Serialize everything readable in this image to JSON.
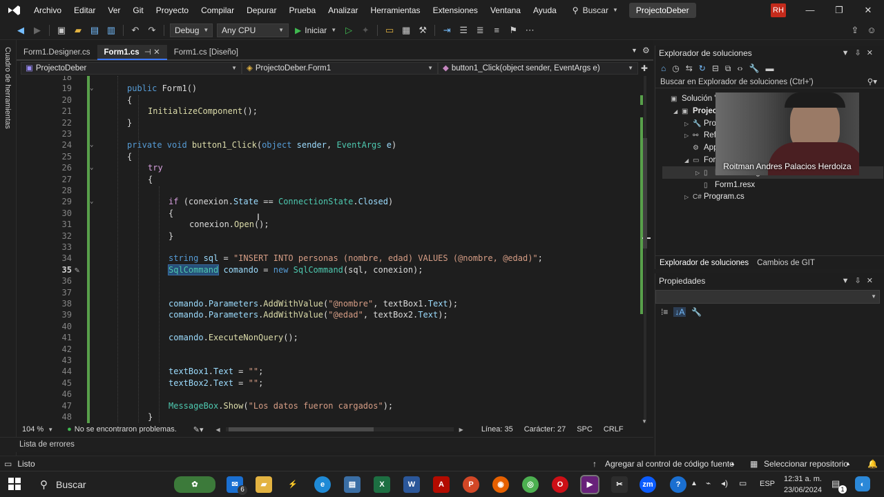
{
  "menubar": {
    "items": [
      "Archivo",
      "Editar",
      "Ver",
      "Git",
      "Proyecto",
      "Compilar",
      "Depurar",
      "Prueba",
      "Analizar",
      "Herramientas",
      "Extensiones",
      "Ventana",
      "Ayuda"
    ],
    "search_label": "Buscar",
    "project_name": "ProjectoDeber",
    "user_initials": "RH"
  },
  "toolbar": {
    "config": "Debug",
    "platform": "Any CPU",
    "run_label": "Iniciar"
  },
  "left_tab": "Cuadro de herramientas",
  "editor": {
    "tabs": [
      {
        "label": "Form1.Designer.cs",
        "active": false
      },
      {
        "label": "Form1.cs",
        "active": true
      },
      {
        "label": "Form1.cs [Diseño]",
        "active": false
      }
    ],
    "nav_project": "ProjectoDeber",
    "nav_class": "ProjectoDeber.Form1",
    "nav_member": "button1_Click(object sender, EventArgs e)",
    "zoom": "104 %",
    "problems": "No se encontraron problemas.",
    "line": "Línea: 35",
    "char": "Carácter: 27",
    "spc": "SPC",
    "crlf": "CRLF",
    "current_line": 35,
    "code_lines": [
      {
        "n": "18",
        "tokens": []
      },
      {
        "n": "19",
        "tokens": [
          [
            "kw",
            "public "
          ],
          [
            "tx",
            "Form1()"
          ]
        ],
        "indent": 2
      },
      {
        "n": "20",
        "tokens": [
          [
            "tx",
            "{"
          ]
        ],
        "indent": 2
      },
      {
        "n": "21",
        "tokens": [
          [
            "fn",
            "InitializeComponent"
          ],
          [
            "tx",
            "();"
          ]
        ],
        "indent": 3
      },
      {
        "n": "22",
        "tokens": [
          [
            "tx",
            "}"
          ]
        ],
        "indent": 2
      },
      {
        "n": "23",
        "tokens": []
      },
      {
        "n": "24",
        "tokens": [
          [
            "kw",
            "private void "
          ],
          [
            "fn",
            "button1_Click"
          ],
          [
            "tx",
            "("
          ],
          [
            "kw",
            "object "
          ],
          [
            "id",
            "sender"
          ],
          [
            "tx",
            ", "
          ],
          [
            "ty",
            "EventArgs "
          ],
          [
            "id",
            "e"
          ],
          [
            "tx",
            ")"
          ]
        ],
        "indent": 2
      },
      {
        "n": "25",
        "tokens": [
          [
            "tx",
            "{"
          ]
        ],
        "indent": 2
      },
      {
        "n": "26",
        "tokens": [
          [
            "kw2",
            "try"
          ]
        ],
        "indent": 3
      },
      {
        "n": "27",
        "tokens": [
          [
            "tx",
            "{"
          ]
        ],
        "indent": 3
      },
      {
        "n": "28",
        "tokens": []
      },
      {
        "n": "29",
        "tokens": [
          [
            "kw2",
            "if "
          ],
          [
            "tx",
            "(conexion."
          ],
          [
            "id",
            "State"
          ],
          [
            "tx",
            " == "
          ],
          [
            "ty",
            "ConnectionState"
          ],
          [
            "tx",
            "."
          ],
          [
            "id",
            "Closed"
          ],
          [
            "tx",
            ")"
          ]
        ],
        "indent": 4
      },
      {
        "n": "30",
        "tokens": [
          [
            "tx",
            "{"
          ]
        ],
        "indent": 4
      },
      {
        "n": "31",
        "tokens": [
          [
            "tx",
            "conexion."
          ],
          [
            "fn",
            "Open"
          ],
          [
            "tx",
            "();"
          ]
        ],
        "indent": 5
      },
      {
        "n": "32",
        "tokens": [
          [
            "tx",
            "}"
          ]
        ],
        "indent": 4
      },
      {
        "n": "33",
        "tokens": []
      },
      {
        "n": "34",
        "tokens": [
          [
            "kw",
            "string "
          ],
          [
            "id",
            "sql"
          ],
          [
            "tx",
            " = "
          ],
          [
            "str",
            "\"INSERT INTO personas (nombre, edad) VALUES (@nombre, @edad)\""
          ],
          [
            "tx",
            ";"
          ]
        ],
        "indent": 4
      },
      {
        "n": "35",
        "tokens": [
          [
            "sel",
            "SqlCommand"
          ],
          [
            "tx",
            " "
          ],
          [
            "id",
            "comando"
          ],
          [
            "tx",
            " = "
          ],
          [
            "kw",
            "new "
          ],
          [
            "ty",
            "SqlCommand"
          ],
          [
            "tx",
            "(sql, conexion);"
          ]
        ],
        "indent": 4
      },
      {
        "n": "36",
        "tokens": []
      },
      {
        "n": "37",
        "tokens": []
      },
      {
        "n": "38",
        "tokens": [
          [
            "id",
            "comando"
          ],
          [
            "tx",
            "."
          ],
          [
            "id",
            "Parameters"
          ],
          [
            "tx",
            "."
          ],
          [
            "fn",
            "AddWithValue"
          ],
          [
            "tx",
            "("
          ],
          [
            "str",
            "\"@nombre\""
          ],
          [
            "tx",
            ", textBox1."
          ],
          [
            "id",
            "Text"
          ],
          [
            "tx",
            ");"
          ]
        ],
        "indent": 4
      },
      {
        "n": "39",
        "tokens": [
          [
            "id",
            "comando"
          ],
          [
            "tx",
            "."
          ],
          [
            "id",
            "Parameters"
          ],
          [
            "tx",
            "."
          ],
          [
            "fn",
            "AddWithValue"
          ],
          [
            "tx",
            "("
          ],
          [
            "str",
            "\"@edad\""
          ],
          [
            "tx",
            ", textBox2."
          ],
          [
            "id",
            "Text"
          ],
          [
            "tx",
            ");"
          ]
        ],
        "indent": 4
      },
      {
        "n": "40",
        "tokens": []
      },
      {
        "n": "41",
        "tokens": [
          [
            "id",
            "comando"
          ],
          [
            "tx",
            "."
          ],
          [
            "fn",
            "ExecuteNonQuery"
          ],
          [
            "tx",
            "();"
          ]
        ],
        "indent": 4
      },
      {
        "n": "42",
        "tokens": []
      },
      {
        "n": "43",
        "tokens": []
      },
      {
        "n": "44",
        "tokens": [
          [
            "id",
            "textBox1"
          ],
          [
            "tx",
            "."
          ],
          [
            "id",
            "Text"
          ],
          [
            "tx",
            " = "
          ],
          [
            "str",
            "\"\""
          ],
          [
            "tx",
            ";"
          ]
        ],
        "indent": 4
      },
      {
        "n": "45",
        "tokens": [
          [
            "id",
            "textBox2"
          ],
          [
            "tx",
            "."
          ],
          [
            "id",
            "Text"
          ],
          [
            "tx",
            " = "
          ],
          [
            "str",
            "\"\""
          ],
          [
            "tx",
            ";"
          ]
        ],
        "indent": 4
      },
      {
        "n": "46",
        "tokens": []
      },
      {
        "n": "47",
        "tokens": [
          [
            "ty",
            "MessageBox"
          ],
          [
            "tx",
            "."
          ],
          [
            "fn",
            "Show"
          ],
          [
            "tx",
            "("
          ],
          [
            "str",
            "\"Los datos fueron cargados\""
          ],
          [
            "tx",
            ");"
          ]
        ],
        "indent": 4
      },
      {
        "n": "48",
        "tokens": [
          [
            "tx",
            "}"
          ]
        ],
        "indent": 3
      }
    ]
  },
  "error_list_tab": "Lista de errores",
  "solution_explorer": {
    "title": "Explorador de soluciones",
    "search_placeholder": "Buscar en Explorador de soluciones (Ctrl+')",
    "tree": [
      {
        "label": "Solución \"",
        "level": 0,
        "arrow": "",
        "icon": "solution-icon"
      },
      {
        "label": "Project",
        "level": 1,
        "arrow": "down",
        "icon": "csharp-project-icon",
        "bold": true
      },
      {
        "label": "Prop",
        "level": 2,
        "arrow": "right",
        "icon": "wrench-icon"
      },
      {
        "label": "Refe",
        "level": 2,
        "arrow": "right",
        "icon": "references-icon"
      },
      {
        "label": "App",
        "level": 2,
        "arrow": "",
        "icon": "config-icon"
      },
      {
        "label": "Form",
        "level": 2,
        "arrow": "down",
        "icon": "form-icon"
      },
      {
        "label": "Form1.Designer.cs",
        "level": 3,
        "arrow": "right",
        "icon": "file-icon"
      },
      {
        "label": "Form1.resx",
        "level": 3,
        "arrow": "",
        "icon": "file-icon"
      },
      {
        "label": "Program.cs",
        "level": 2,
        "arrow": "right",
        "icon": "csharp-file-icon"
      }
    ],
    "tabs": [
      "Explorador de soluciones",
      "Cambios de GIT"
    ]
  },
  "webcam": {
    "name": "Roitman Andres Palacios Herdoiza"
  },
  "properties": {
    "title": "Propiedades"
  },
  "status": {
    "ready": "Listo",
    "source_control": "Agregar al control de código fuente",
    "repo": "Seleccionar repositorio"
  },
  "taskbar": {
    "search": "Buscar",
    "mail_badge": "6",
    "lang": "ESP",
    "time": "12:31 a. m.",
    "date": "23/06/2024",
    "notif_badge": "1"
  },
  "colors": {
    "accent": "#3b78ff",
    "run_green": "#3fb950",
    "selection": "#264f78",
    "change_bar": "#58a04a"
  }
}
